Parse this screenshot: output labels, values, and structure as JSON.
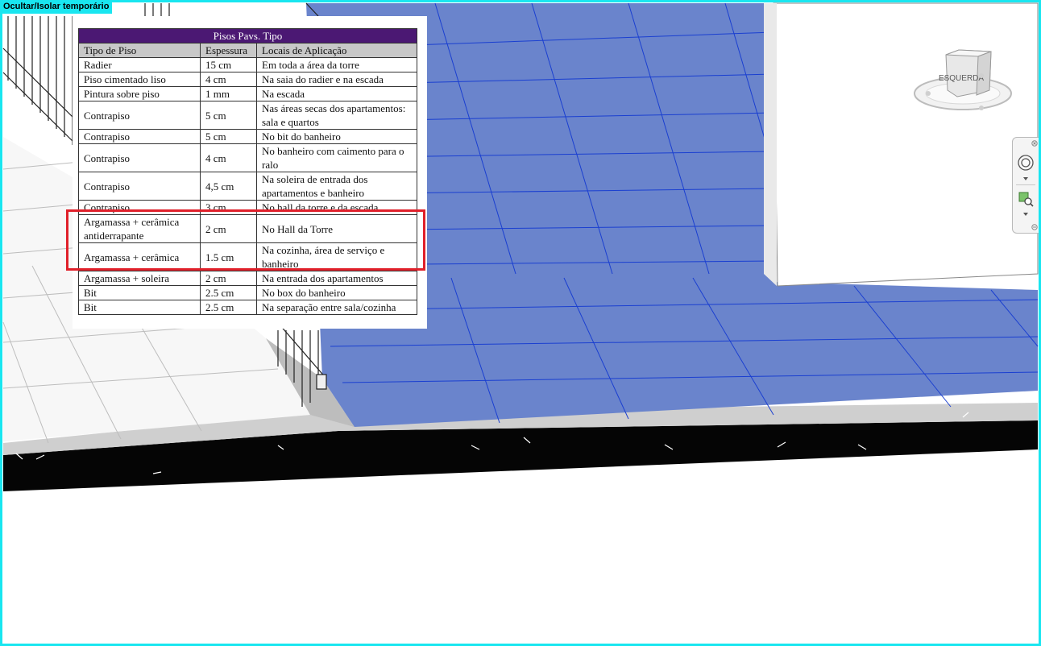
{
  "view": {
    "mode_label": "Ocultar/Isolar temporário",
    "frame_color": "#19e6f0"
  },
  "colors": {
    "floor_blue": "#6a84cc",
    "floor_grid": "#1a3fd0",
    "slab_black": "#050505",
    "highlight": "#e0202a",
    "table_title_bg": "#4b1873"
  },
  "viewcube": {
    "face_label": "ESQUERDA"
  },
  "navigation_bar": {
    "buttons": [
      "steering-wheel-icon",
      "zoom-region-icon"
    ]
  },
  "table": {
    "title": "Pisos Pavs. Tipo",
    "headers": [
      "Tipo de Piso",
      "Espessura",
      "Locais de Aplicação"
    ],
    "rows": [
      {
        "tipo": "Radier",
        "espessura": "15 cm",
        "local": "Em toda a área da torre"
      },
      {
        "tipo": "Piso cimentado liso",
        "espessura": "4 cm",
        "local": "Na saia do radier e na escada"
      },
      {
        "tipo": "Pintura sobre piso",
        "espessura": "1 mm",
        "local": "Na escada"
      },
      {
        "tipo": "Contrapiso",
        "espessura": "5 cm",
        "local": "Nas áreas secas dos apartamentos: sala e quartos"
      },
      {
        "tipo": "Contrapiso",
        "espessura": "5 cm",
        "local": "No bit do banheiro"
      },
      {
        "tipo": "Contrapiso",
        "espessura": "4 cm",
        "local": "No banheiro com caimento para o ralo"
      },
      {
        "tipo": "Contrapiso",
        "espessura": "4,5 cm",
        "local": "Na soleira de entrada dos apartamentos e banheiro"
      },
      {
        "tipo": "Contrapiso",
        "espessura": "3 cm",
        "local": "No hall da torre e da escada"
      },
      {
        "tipo": "Argamassa + cerâmica antiderrapante",
        "espessura": "2 cm",
        "local": "No Hall da Torre"
      },
      {
        "tipo": "Argamassa + cerâmica",
        "espessura": "1.5 cm",
        "local": "Na cozinha, área de serviço e banheiro"
      },
      {
        "tipo": "Argamassa + soleira",
        "espessura": "2 cm",
        "local": "Na entrada dos apartamentos"
      },
      {
        "tipo": "Bit",
        "espessura": "2.5 cm",
        "local": "No box do banheiro"
      },
      {
        "tipo": "Bit",
        "espessura": "2.5 cm",
        "local": "Na separação entre sala/cozinha"
      }
    ]
  }
}
